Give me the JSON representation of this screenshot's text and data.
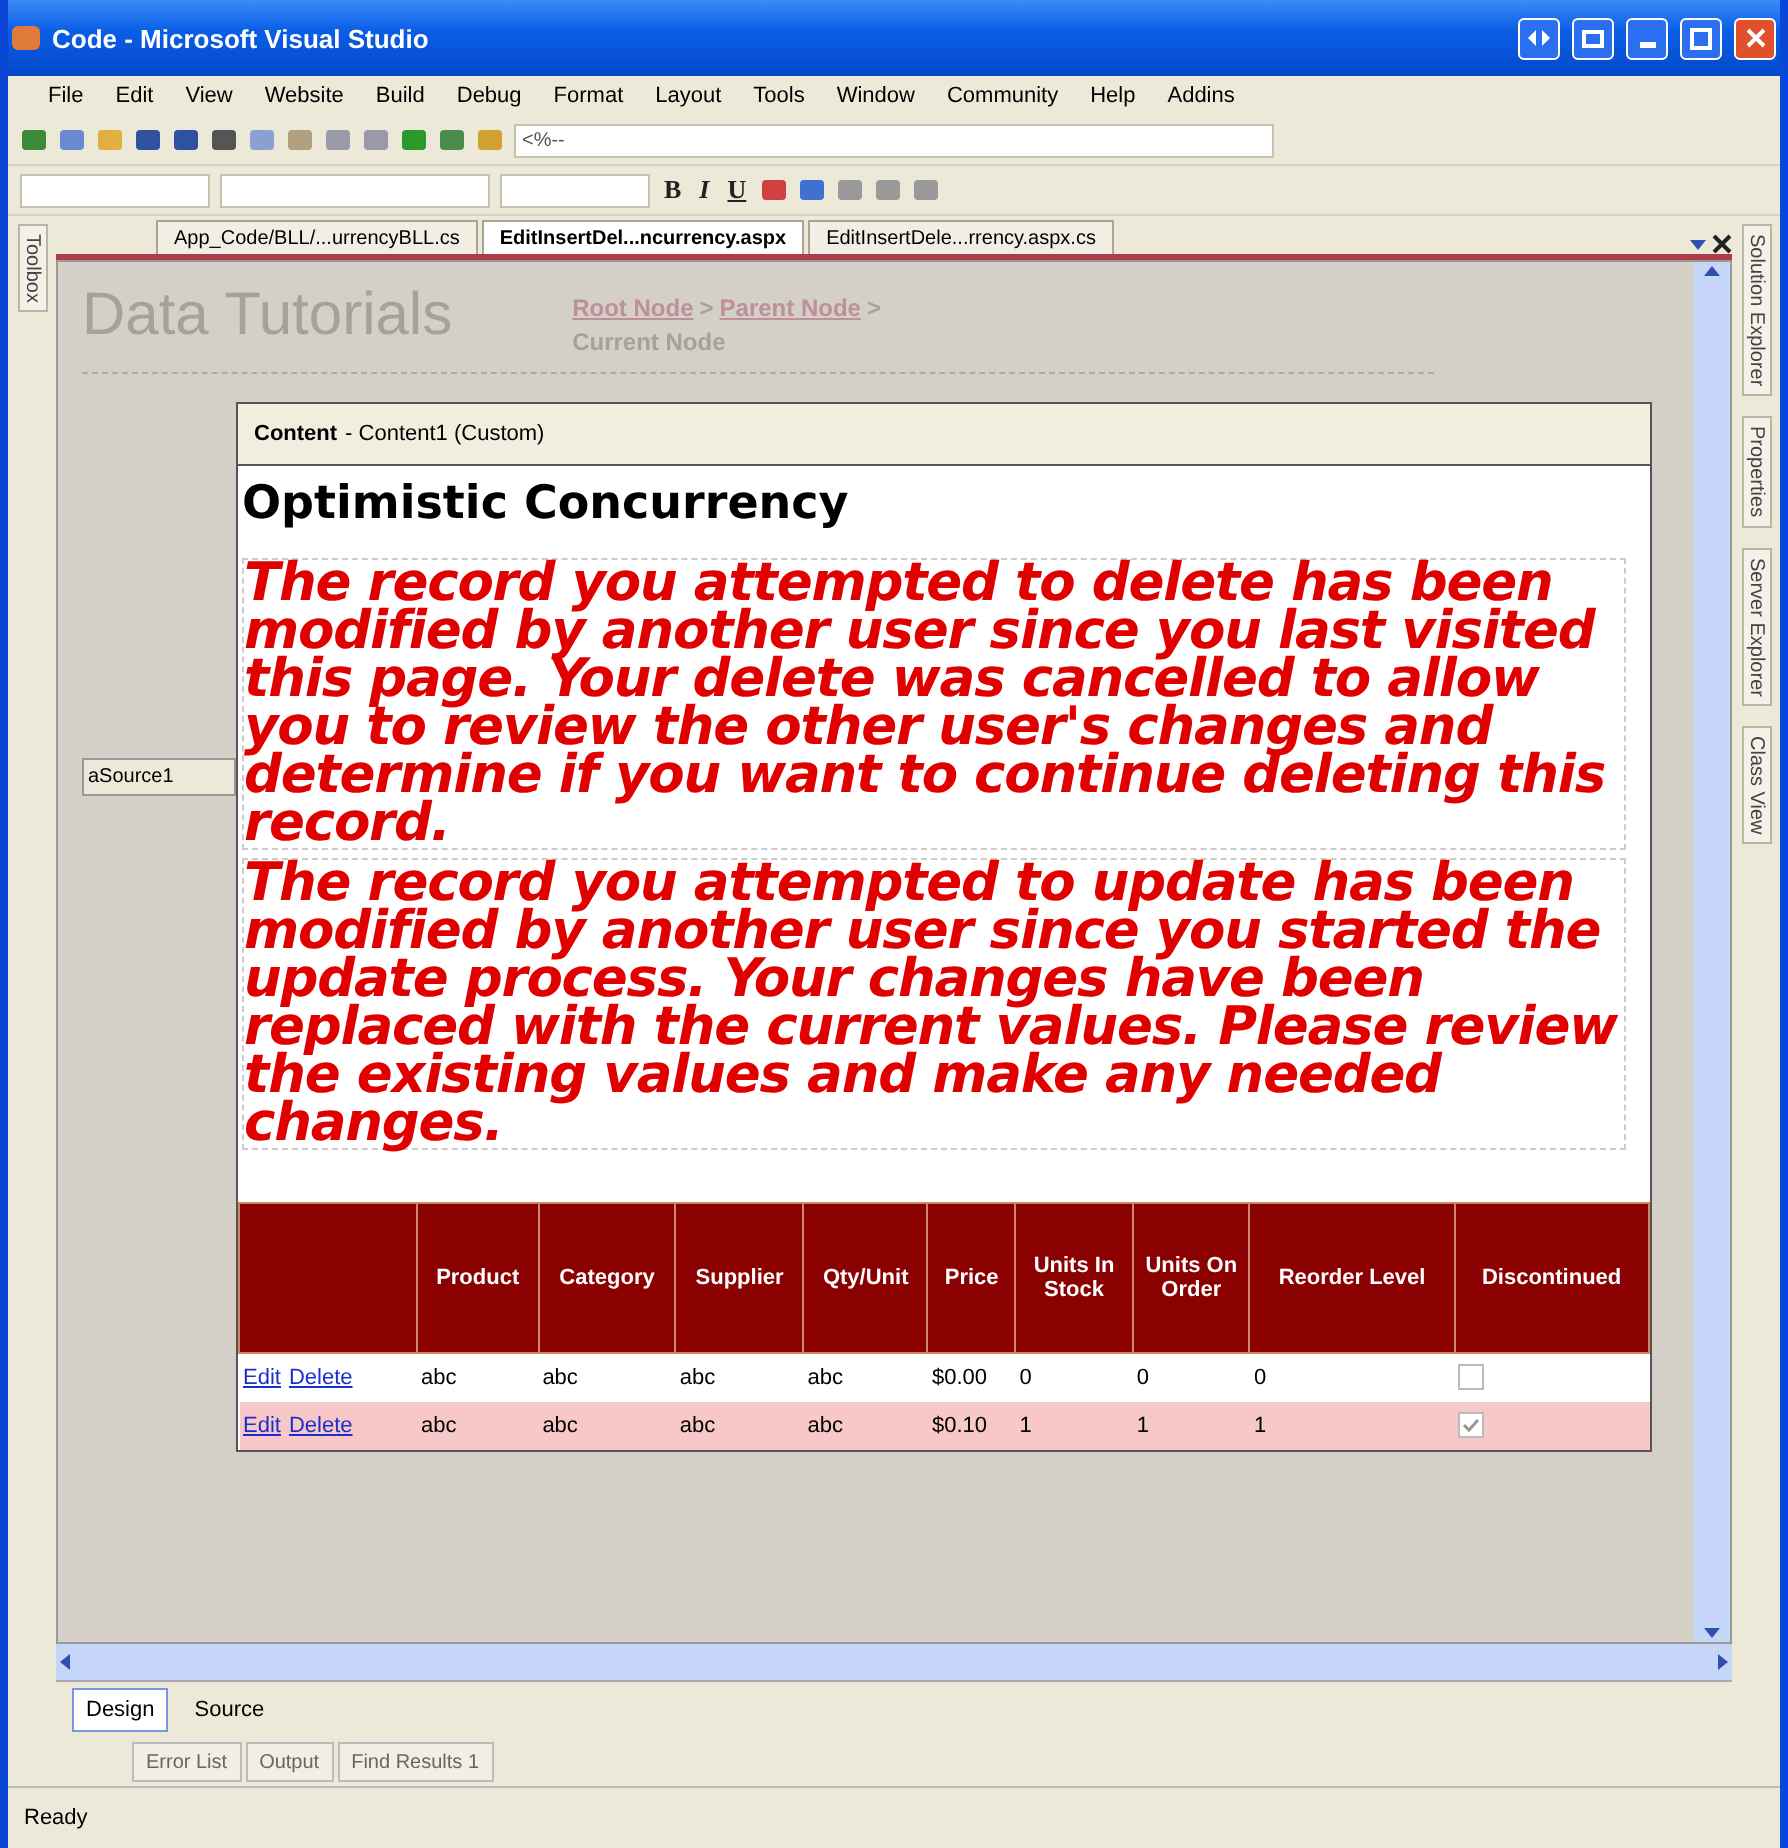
{
  "window": {
    "title": "Code - Microsoft Visual Studio"
  },
  "menu": [
    "File",
    "Edit",
    "View",
    "Website",
    "Build",
    "Debug",
    "Format",
    "Layout",
    "Tools",
    "Window",
    "Community",
    "Help",
    "Addins"
  ],
  "toolbar": {
    "directive_field": "<%--"
  },
  "format_toolbar": {
    "buttons": [
      "B",
      "I",
      "U"
    ]
  },
  "document_tabs": [
    {
      "label": "App_Code/BLL/...urrencyBLL.cs",
      "selected": false
    },
    {
      "label": "EditInsertDel...ncurrency.aspx",
      "selected": true
    },
    {
      "label": "EditInsertDele...rrency.aspx.cs",
      "selected": false
    }
  ],
  "side_panels": {
    "left": [
      "Toolbox"
    ],
    "right": [
      "Solution Explorer",
      "Properties",
      "Server Explorer",
      "Class View"
    ]
  },
  "design": {
    "site_title": "Data Tutorials",
    "breadcrumb": [
      {
        "label": "Root Node",
        "kind": "link"
      },
      {
        "label": ">",
        "kind": "separator"
      },
      {
        "label": "Parent Node",
        "kind": "link"
      },
      {
        "label": ">",
        "kind": "separator"
      },
      {
        "label": "Current Node",
        "kind": "current"
      }
    ],
    "data_source_label": "aSource1",
    "content_header": {
      "name": "Content",
      "detail": "- Content1 (Custom)"
    },
    "heading": "Optimistic Concurrency",
    "messages": [
      "The record you attempted to delete has been modified by another user since you last visited this page. Your delete was cancelled to allow you to review the other user's changes and determine if you want to continue deleting this record.",
      "The record you attempted to update has been modified by another user since you started the update process. Your changes have been replaced with the current values. Please review the existing values and make any needed changes."
    ],
    "grid": {
      "columns": [
        "Product",
        "Category",
        "Supplier",
        "Qty/Unit",
        "Price",
        "Units In Stock",
        "Units On Order",
        "Reorder Level",
        "Discontinued"
      ],
      "rows": [
        {
          "links": [
            "Edit",
            "Delete"
          ],
          "cells": [
            "abc",
            "abc",
            "abc",
            "abc",
            "$0.00",
            "0",
            "0",
            "0"
          ],
          "discontinued": false,
          "alternate": false
        },
        {
          "links": [
            "Edit",
            "Delete"
          ],
          "cells": [
            "abc",
            "abc",
            "abc",
            "abc",
            "$0.10",
            "1",
            "1",
            "1"
          ],
          "discontinued": true,
          "alternate": true
        }
      ]
    }
  },
  "view_tabs": [
    {
      "label": "Design",
      "selected": true
    },
    {
      "label": "Source",
      "selected": false
    }
  ],
  "tool_windows": [
    "Error List",
    "Output",
    "Find Results 1"
  ],
  "status_bar": "Ready"
}
